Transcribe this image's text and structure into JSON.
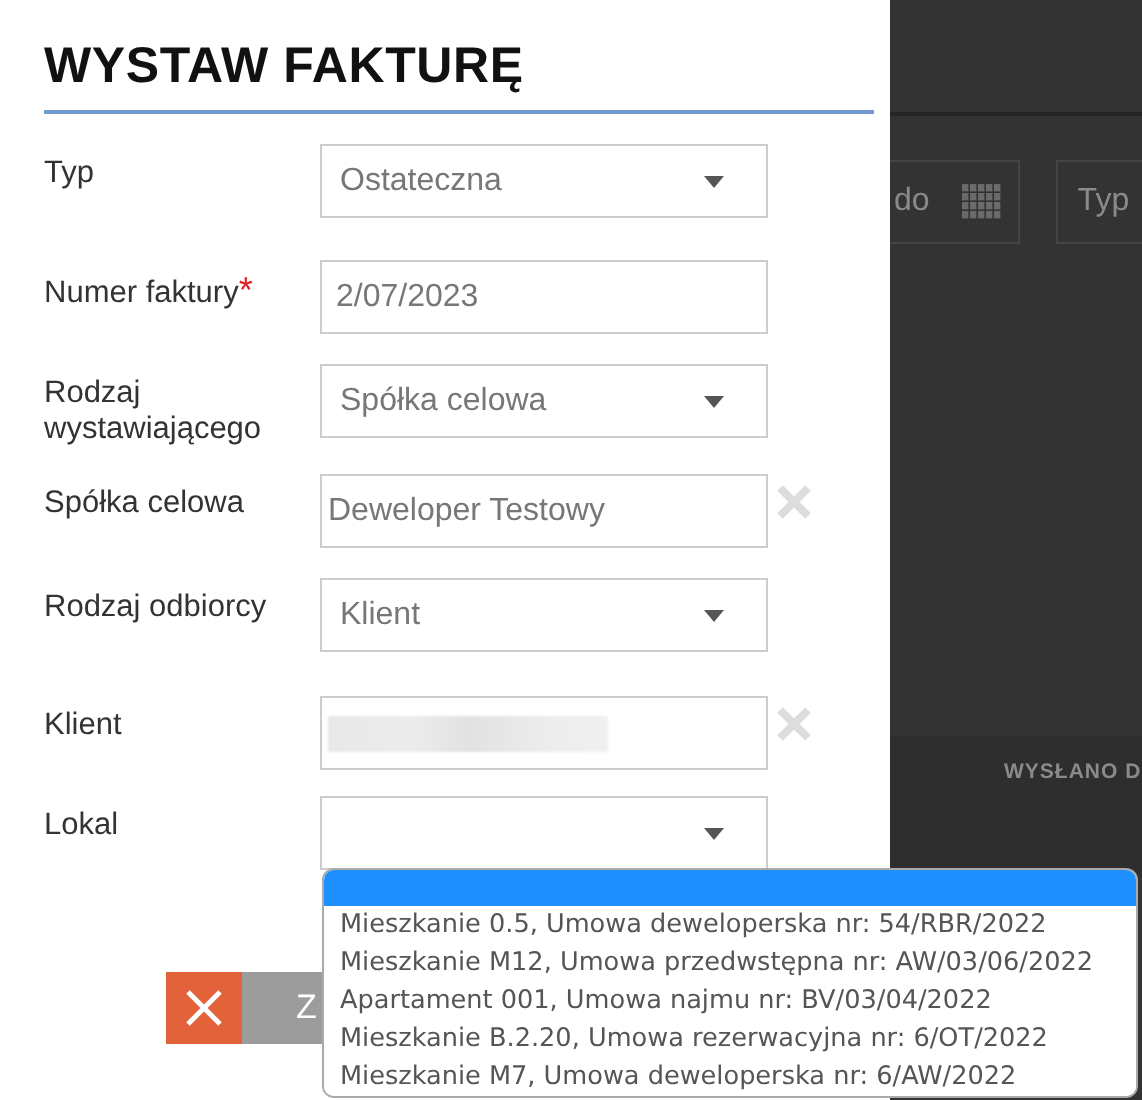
{
  "dialog": {
    "title": "WYSTAW FAKTURĘ",
    "fields": [
      {
        "label": "Typ",
        "kind": "select",
        "value": "Ostateczna"
      },
      {
        "label": "Numer faktury",
        "required_mark": "*",
        "kind": "text",
        "value": "2/07/2023"
      },
      {
        "label": "Rodzaj wystawiającego",
        "kind": "select",
        "value": "Spółka celowa"
      },
      {
        "label": "Spółka celowa",
        "kind": "lookup",
        "value": "Deweloper Testowy"
      },
      {
        "label": "Rodzaj odbiorcy",
        "kind": "select",
        "value": "Klient"
      },
      {
        "label": "Klient",
        "kind": "lookup",
        "redacted": true
      },
      {
        "label": "Lokal",
        "kind": "select",
        "expanded": true,
        "empty_option": {
          "selected": true
        },
        "options": [
          {
            "text": "Mieszkanie 0.5, Umowa deweloperska nr: 54/RBR/2022",
            "selected": false
          },
          {
            "text": "Mieszkanie M12, Umowa przedwstępna nr: AW/03/06/2022",
            "selected": false
          },
          {
            "text": "Apartament 001, Umowa najmu nr: BV/03/04/2022",
            "selected": false
          },
          {
            "text": "Mieszkanie B.2.20, Umowa rezerwacyjna nr: 6/OT/2022",
            "selected": false
          },
          {
            "text": "Mieszkanie M7, Umowa deweloperska nr: 6/AW/2022",
            "selected": false
          }
        ]
      }
    ],
    "buttons": [
      {
        "kind": "cancel"
      },
      {
        "kind": "submit",
        "label": "Z"
      }
    ]
  },
  "background": {
    "date_to_label": "do",
    "type_filter_placeholder": "Typ",
    "column_header": "WYSŁANO D"
  }
}
